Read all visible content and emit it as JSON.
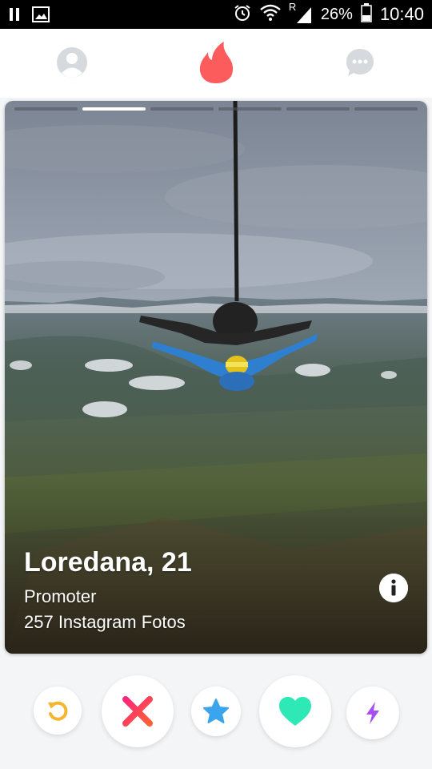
{
  "status_bar": {
    "roaming": "R",
    "battery": "26%",
    "time": "10:40"
  },
  "top_nav": {
    "profile_icon": "profile-icon",
    "logo_icon": "flame-logo-icon",
    "messages_icon": "chat-bubble-icon"
  },
  "card": {
    "photo_count": 6,
    "active_photo": 1,
    "name_age": "Loredana, 21",
    "job": "Promoter",
    "instagram": "257 Instagram Fotos"
  },
  "actions": [
    {
      "name": "rewind-button",
      "icon": "rewind-icon",
      "color": "#f5b52e"
    },
    {
      "name": "nope-button",
      "icon": "x-icon",
      "color": "#fd4f6b"
    },
    {
      "name": "super-like-button",
      "icon": "star-icon",
      "color": "#3aa4ec"
    },
    {
      "name": "like-button",
      "icon": "heart-icon",
      "color": "#2ee8b6"
    },
    {
      "name": "boost-button",
      "icon": "lightning-icon",
      "color": "#a64ff5"
    }
  ],
  "colors": {
    "brand": "#fd5c5c",
    "nav_icon": "#d6d9de"
  }
}
